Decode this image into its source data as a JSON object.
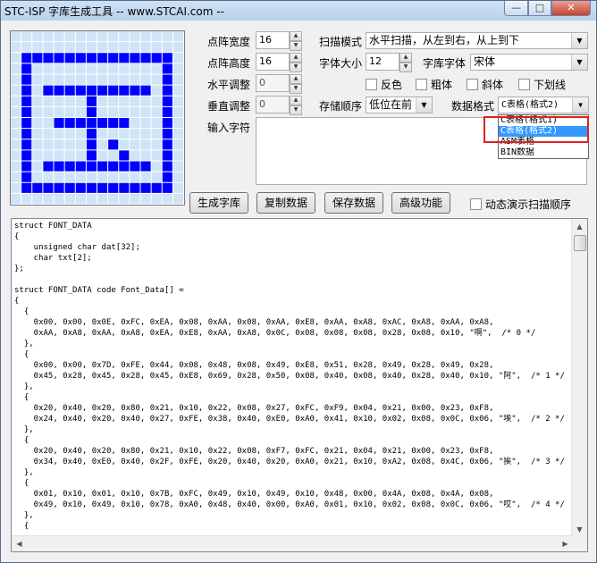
{
  "window": {
    "title": "STC-ISP 字库生成工具 -- www.STCAI.com --",
    "buttons": {
      "minimize": "—",
      "maximize": "□",
      "close": "✕"
    }
  },
  "grid": {
    "size": 16,
    "on_color": "#0000ff",
    "off_color": "#cfe5f7",
    "line_color": "#ffffff",
    "rows": [
      "0000000000000000",
      "0000000000000000",
      "0111111111111110",
      "0100000000000010",
      "0100000000000010",
      "0101111111111010",
      "0100000100000010",
      "0100000100000010",
      "0100111111100010",
      "0100000100000010",
      "0100000101000010",
      "0100000100100010",
      "0101111111111010",
      "0100000000000010",
      "0111111111111110",
      "0000000000000000"
    ]
  },
  "settings": {
    "width_label": "点阵宽度",
    "width_value": "16",
    "height_label": "点阵高度",
    "height_value": "16",
    "hadjust_label": "水平调整",
    "hadjust_value": "0",
    "vadjust_label": "垂直调整",
    "vadjust_value": "0",
    "scan_mode_label": "扫描模式",
    "scan_mode_value": "水平扫描，从左到右，从上到下",
    "font_size_label": "字体大小",
    "font_size_value": "12",
    "font_label": "字库字体",
    "font_value": "宋体",
    "invert_label": "反色",
    "bold_label": "粗体",
    "italic_label": "斜体",
    "underline_label": "下划线",
    "storage_order_label": "存储顺序",
    "storage_order_value": "低位在前",
    "data_format_label": "数据格式",
    "data_format_value": "C表格(格式2)",
    "input_label": "输入字符"
  },
  "dropdown": {
    "options": [
      "C表格(格式1)",
      "C表格(格式2)",
      "ASM表格",
      "BIN数据"
    ],
    "selected_index": 1
  },
  "actions": {
    "generate": "生成字库",
    "copy": "复制数据",
    "save": "保存数据",
    "advanced": "高级功能",
    "demo_label": "动态演示扫描顺序"
  },
  "code_lines": [
    "struct FONT_DATA",
    "{",
    "    unsigned char dat[32];",
    "    char txt[2];",
    "};",
    "",
    "struct FONT_DATA code Font_Data[] =",
    "{",
    "  {",
    "    0x00, 0x00, 0x0E, 0xFC, 0xEA, 0x08, 0xAA, 0x08, 0xAA, 0xE8, 0xAA, 0xA8, 0xAC, 0xA8, 0xAA, 0xA8,",
    "    0xAA, 0xA8, 0xAA, 0xA8, 0xEA, 0xE8, 0xAA, 0xA8, 0x0C, 0x08, 0x08, 0x08, 0x28, 0x08, 0x10, \"啊\",  /* 0 */",
    "  },",
    "  {",
    "    0x00, 0x00, 0x7D, 0xFE, 0x44, 0x08, 0x48, 0x08, 0x49, 0xE8, 0x51, 0x28, 0x49, 0x28, 0x49, 0x28,",
    "    0x45, 0x28, 0x45, 0x28, 0x45, 0xE8, 0x69, 0x28, 0x50, 0x08, 0x40, 0x08, 0x40, 0x28, 0x40, 0x10, \"阿\",  /* 1 */",
    "  },",
    "  {",
    "    0x20, 0x40, 0x20, 0x80, 0x21, 0x10, 0x22, 0x08, 0x27, 0xFC, 0xF9, 0x04, 0x21, 0x00, 0x23, 0xF8,",
    "    0x24, 0x40, 0x20, 0x40, 0x27, 0xFE, 0x38, 0x40, 0xE0, 0xA0, 0x41, 0x10, 0x02, 0x08, 0x0C, 0x06, \"埃\",  /* 2 */",
    "  },",
    "  {",
    "    0x20, 0x40, 0x20, 0x80, 0x21, 0x10, 0x22, 0x08, 0xF7, 0xFC, 0x21, 0x04, 0x21, 0x00, 0x23, 0xF8,",
    "    0x34, 0x40, 0xE0, 0x40, 0x2F, 0xFE, 0x20, 0x40, 0x20, 0xA0, 0x21, 0x10, 0xA2, 0x08, 0x4C, 0x06, \"挨\",  /* 3 */",
    "  },",
    "  {",
    "    0x01, 0x10, 0x01, 0x10, 0x7B, 0xFC, 0x49, 0x10, 0x49, 0x10, 0x48, 0x00, 0x4A, 0x08, 0x4A, 0x08,",
    "    0x49, 0x10, 0x49, 0x10, 0x78, 0xA0, 0x48, 0x40, 0x00, 0xA0, 0x01, 0x10, 0x02, 0x08, 0x0C, 0x06, \"哎\",  /* 4 */",
    "  },",
    "  {"
  ]
}
